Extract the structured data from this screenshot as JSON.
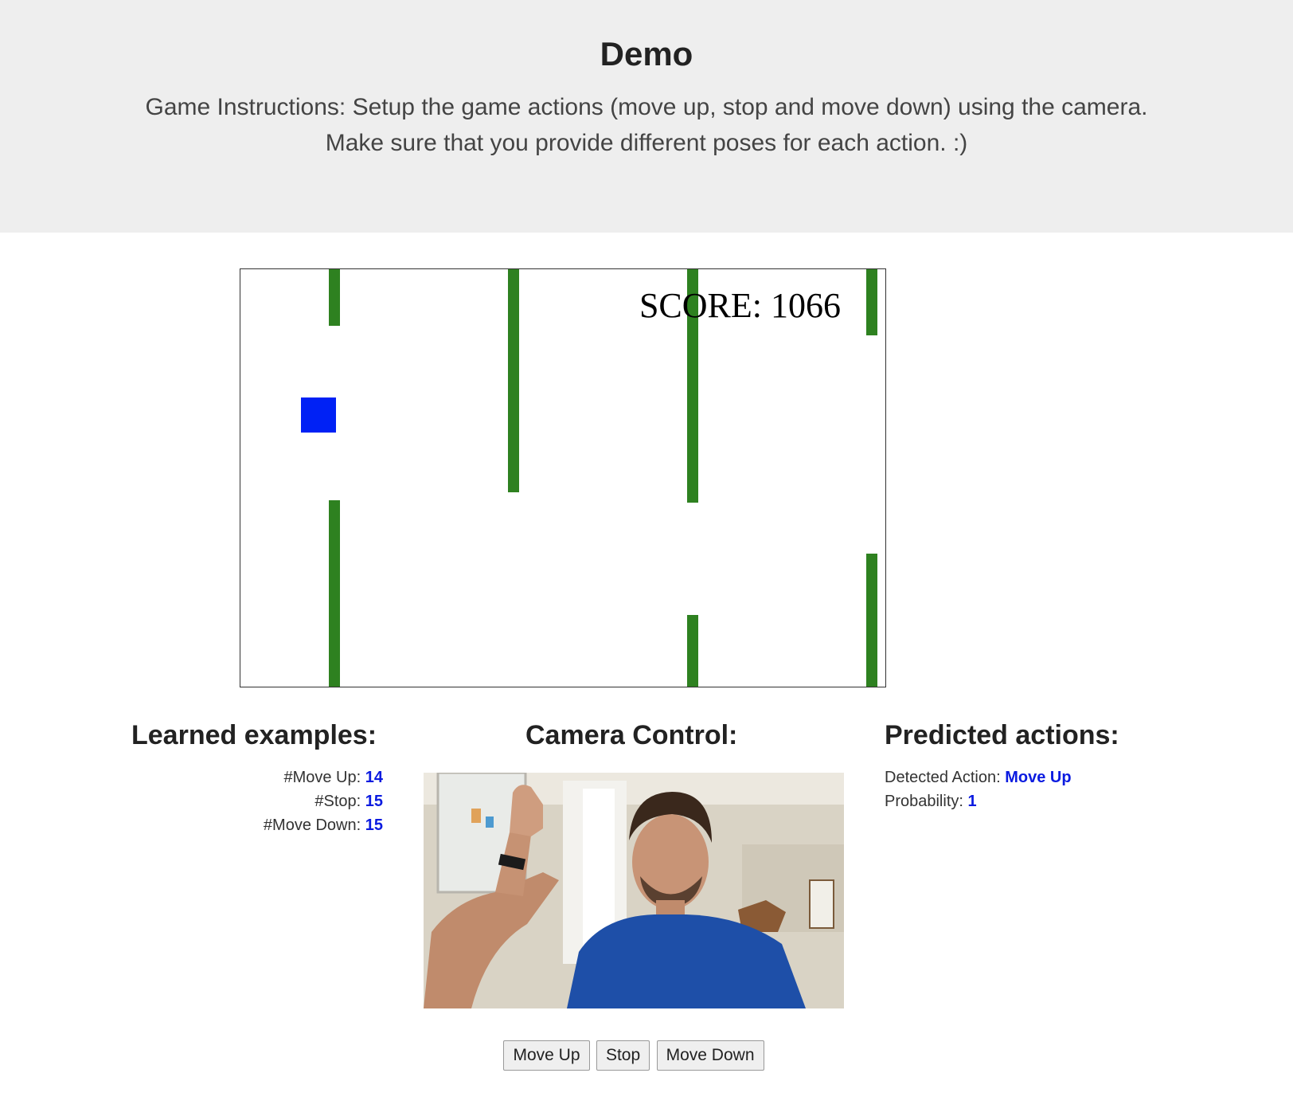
{
  "header": {
    "title": "Demo",
    "instructions_line1": "Game Instructions: Setup the game actions (move up, stop and move down) using the camera.",
    "instructions_line2": "Make sure that you provide different poses for each action. :)"
  },
  "game": {
    "score_text": "SCORE: 1066",
    "player_color": "#0021f5",
    "pipe_color": "#2e8120"
  },
  "learned": {
    "title": "Learned examples:",
    "move_up_label": "#Move Up:",
    "move_up_count": "14",
    "stop_label": "#Stop:",
    "stop_count": "15",
    "move_down_label": "#Move Down:",
    "move_down_count": "15"
  },
  "camera": {
    "title": "Camera Control:"
  },
  "predicted": {
    "title": "Predicted actions:",
    "detected_label": "Detected Action:",
    "detected_value": "Move Up",
    "probability_label": "Probability:",
    "probability_value": "1"
  },
  "buttons": {
    "move_up": "Move Up",
    "stop": "Stop",
    "move_down": "Move Down"
  },
  "colors": {
    "banner_bg": "#eeeeee",
    "value_blue": "#0b1be0"
  }
}
